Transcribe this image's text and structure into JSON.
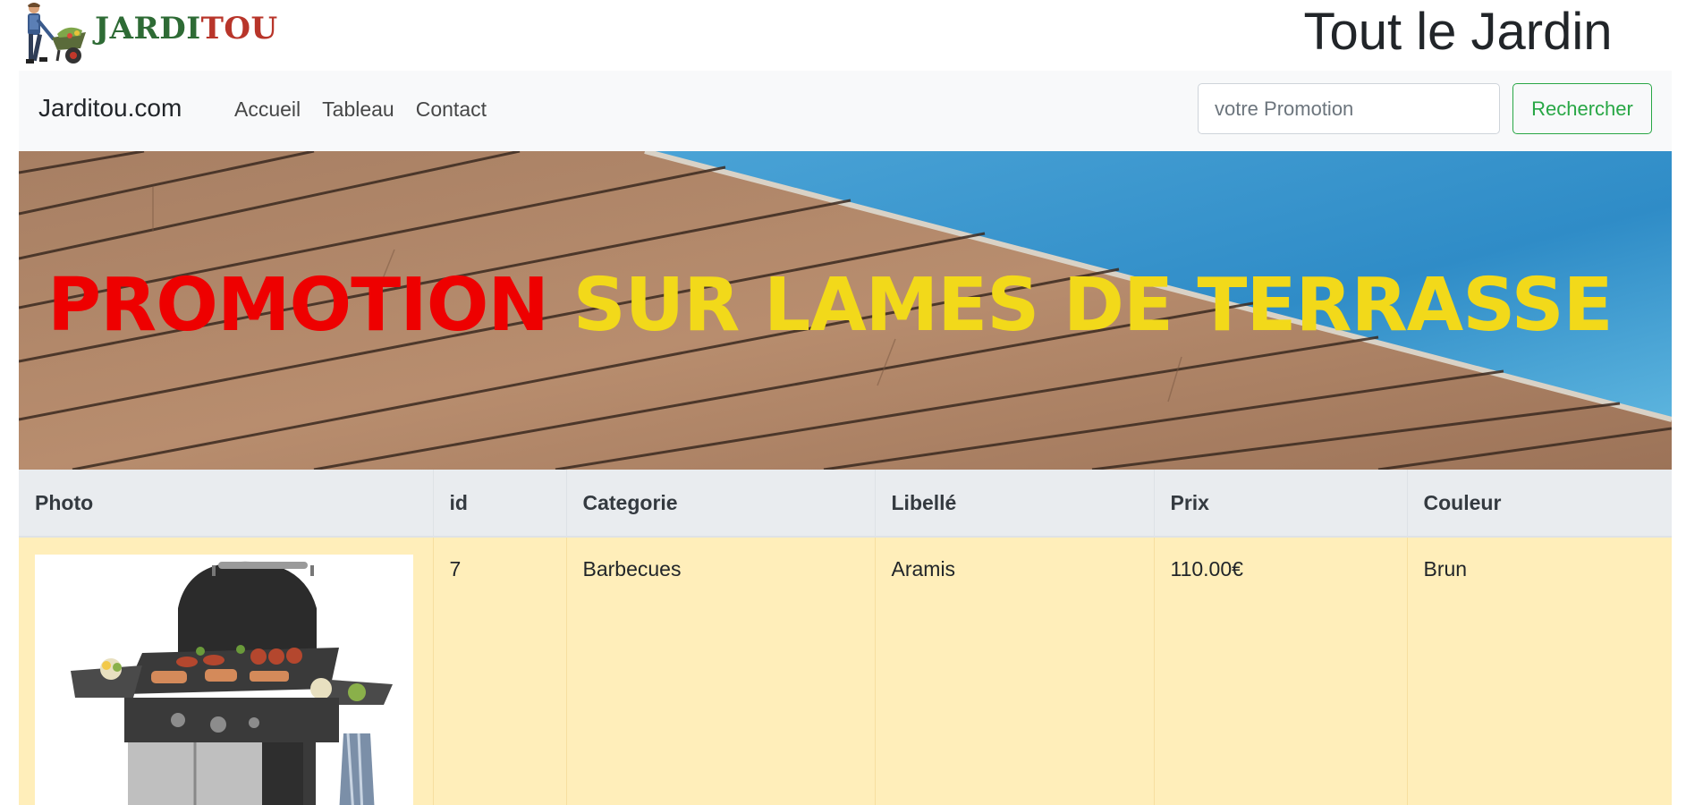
{
  "header": {
    "logo_text_part1": "JARDI",
    "logo_text_part2": "TOU",
    "site_title": "Tout le Jardin"
  },
  "navbar": {
    "brand": "Jarditou.com",
    "links": [
      {
        "label": "Accueil"
      },
      {
        "label": "Tableau"
      },
      {
        "label": "Contact"
      }
    ],
    "search": {
      "placeholder": "votre Promotion",
      "value": "",
      "button_label": "Rechercher"
    }
  },
  "banner": {
    "text_part1": "PROMOTION",
    "text_part2": "SUR LAMES DE TERRASSE"
  },
  "table": {
    "columns": [
      "Photo",
      "id",
      "Categorie",
      "Libellé",
      "Prix",
      "Couleur"
    ],
    "rows": [
      {
        "photo": "barbecue-grill-image",
        "id": "7",
        "categorie": "Barbecues",
        "libelle": "Aramis",
        "prix": "110.00€",
        "couleur": "Brun"
      }
    ]
  },
  "colors": {
    "navbar_bg": "#f8f9fa",
    "success": "#28a745",
    "row_warning_bg": "#ffeeba",
    "table_head_bg": "#e9ecef",
    "banner_red": "#ee0000",
    "banner_yellow": "#f2d91a"
  }
}
